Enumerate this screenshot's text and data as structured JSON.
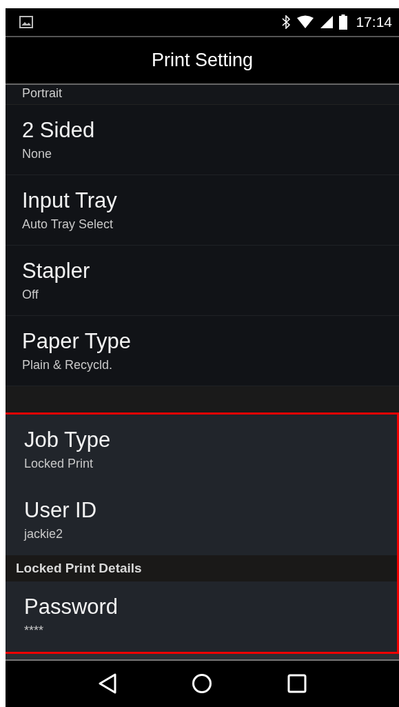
{
  "status_bar": {
    "time": "17:14"
  },
  "title_bar": {
    "title": "Print Setting"
  },
  "partial_item": {
    "value": "Portrait"
  },
  "settings": [
    {
      "label": "2 Sided",
      "value": "None"
    },
    {
      "label": "Input Tray",
      "value": "Auto Tray Select"
    },
    {
      "label": "Stapler",
      "value": "Off"
    },
    {
      "label": "Paper Type",
      "value": "Plain & Recycld."
    }
  ],
  "highlighted_section": {
    "items": [
      {
        "kind": "setting",
        "label": "Job Type",
        "value": "Locked Print"
      },
      {
        "kind": "setting",
        "label": "User ID",
        "value": "jackie2"
      },
      {
        "kind": "header",
        "label": "Locked Print Details"
      },
      {
        "kind": "setting",
        "label": "Password",
        "value": "****"
      }
    ]
  }
}
